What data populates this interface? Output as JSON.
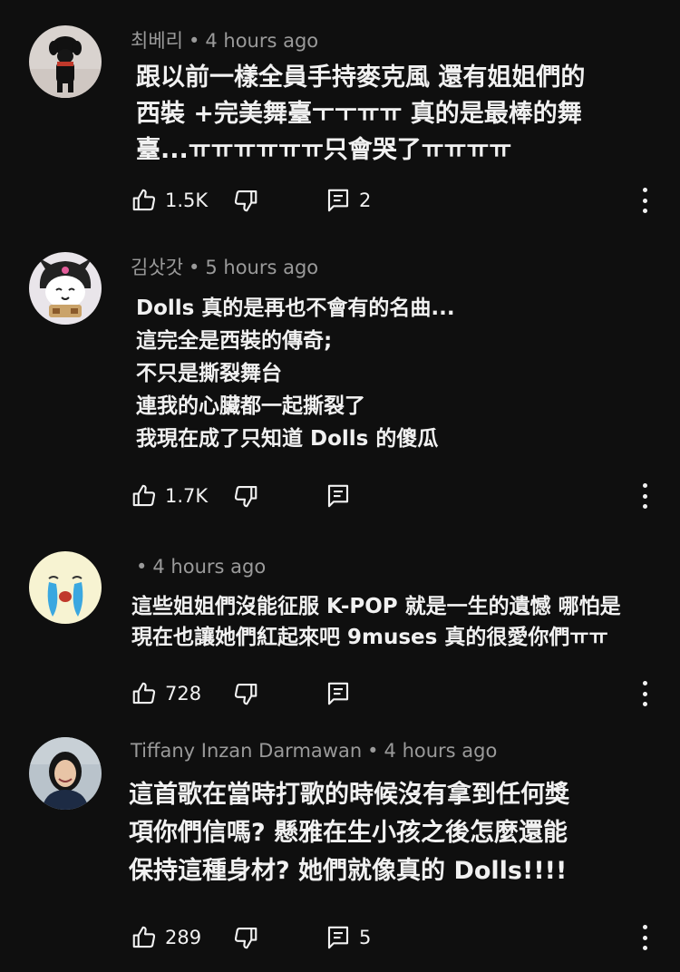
{
  "comments": [
    {
      "author": "최베리",
      "time": "4 hours ago",
      "text": "跟以前一樣全員手持麥克風 還有姐姐們的\n西裝 +完美舞臺ㅜㅜㅠㅠ 真的是最棒的舞\n臺...ㅠㅠㅠㅠㅠㅠ只會哭了ㅠㅠㅠㅠ",
      "likes": "1.5K",
      "replies": "2",
      "avatar_icon": "dog-photo-avatar"
    },
    {
      "author": "김삿갓",
      "time": "5 hours ago",
      "text": "Dolls 真的是再也不會有的名曲...\n這完全是西裝的傳奇;\n不只是撕裂舞台\n連我的心臟都一起撕裂了\n我現在成了只知道 Dolls 的傻瓜",
      "likes": "1.7K",
      "replies": "",
      "avatar_icon": "kuromi-avatar"
    },
    {
      "author": "",
      "time": "4 hours ago",
      "text": "這些姐姐們沒能征服 K-POP 就是一生的遺憾 哪怕是\n現在也讓她們紅起來吧 9muses 真的很愛你們ㅠㅠ",
      "likes": "728",
      "replies": "",
      "avatar_icon": "crying-face-avatar"
    },
    {
      "author": "Tiffany Inzan Darmawan",
      "time": "4 hours ago",
      "text": "這首歌在當時打歌的時候沒有拿到任何獎\n項你們信嗎? 懸雅在生小孩之後怎麼還能\n保持這種身材? 她們就像真的 Dolls!!!!",
      "likes": "289",
      "replies": "5",
      "avatar_icon": "woman-photo-avatar"
    }
  ],
  "icons": {
    "like": "thumbs-up-icon",
    "dislike": "thumbs-down-icon",
    "reply": "reply-icon",
    "more": "more-vertical-icon"
  }
}
